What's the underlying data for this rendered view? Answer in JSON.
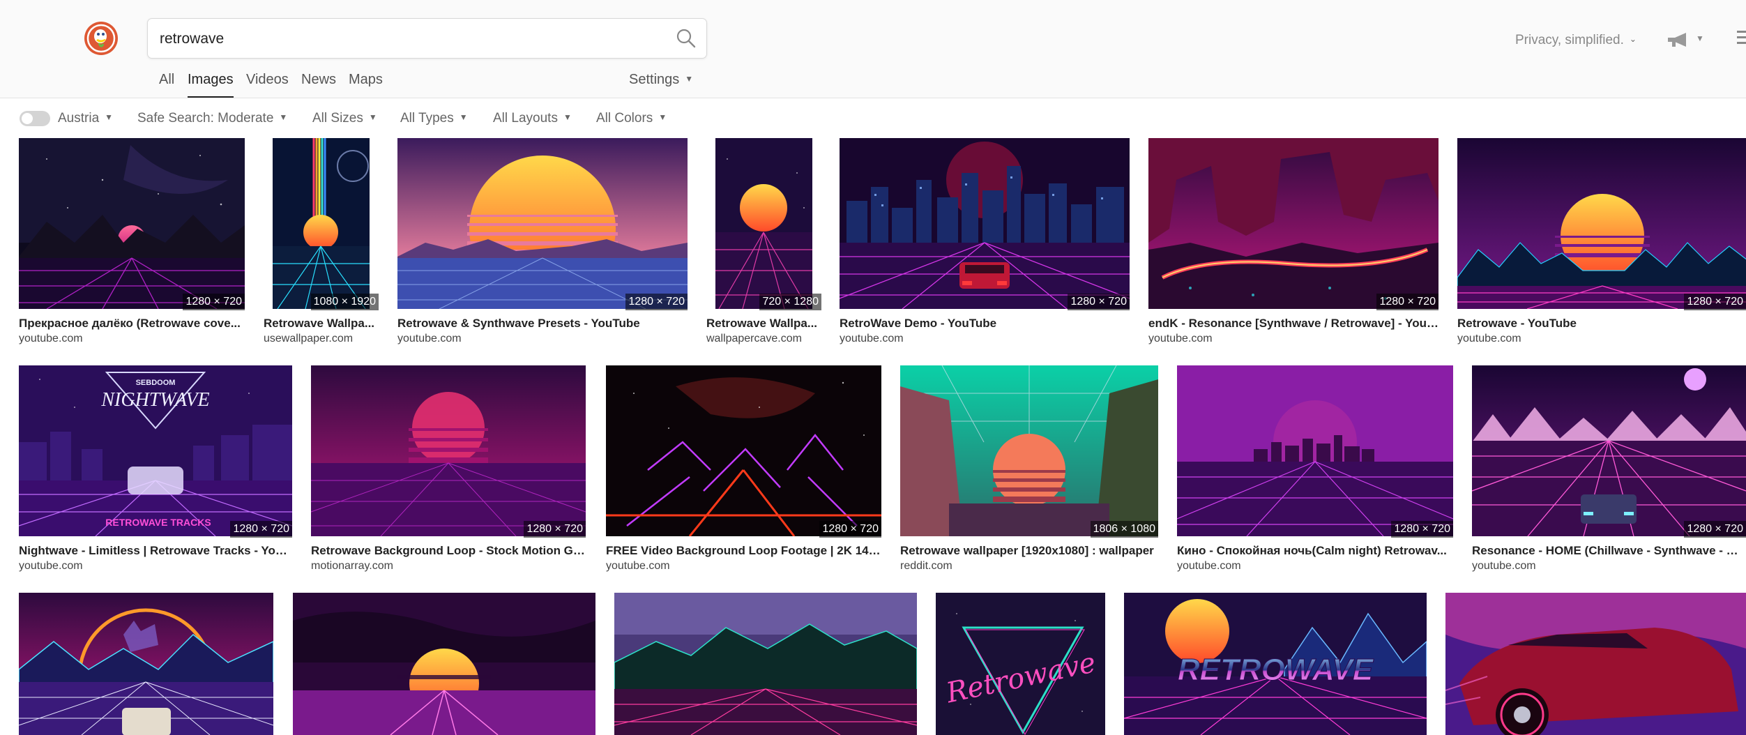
{
  "header": {
    "search_value": "retrowave",
    "tabs": [
      "All",
      "Images",
      "Videos",
      "News",
      "Maps"
    ],
    "settings_label": "Settings",
    "privacy_label": "Privacy, simplified."
  },
  "filters": {
    "region": "Austria",
    "safe_search": "Safe Search: Moderate",
    "sizes": "All Sizes",
    "types": "All Types",
    "layouts": "All Layouts",
    "colors": "All Colors"
  },
  "results": {
    "row1": [
      {
        "title": "Прекрасное далёко (Retrowave cove...",
        "source": "youtube.com",
        "dims": "1280 × 720"
      },
      {
        "title": "Retrowave Wallpa...",
        "source": "usewallpaper.com",
        "dims": "1080 × 1920"
      },
      {
        "title": "Retrowave & Synthwave Presets - YouTube",
        "source": "youtube.com",
        "dims": "1280 × 720"
      },
      {
        "title": "Retrowave Wallpa...",
        "source": "wallpapercave.com",
        "dims": "720 × 1280"
      },
      {
        "title": "RetroWave Demo - YouTube",
        "source": "youtube.com",
        "dims": "1280 × 720"
      },
      {
        "title": "endK - Resonance [Synthwave / Retrowave] - YouT...",
        "source": "youtube.com",
        "dims": "1280 × 720"
      },
      {
        "title": "Retrowave - YouTube",
        "source": "youtube.com",
        "dims": "1280 × 720"
      }
    ],
    "row2": [
      {
        "title": "Nightwave - Limitless | Retrowave Tracks - YouT...",
        "source": "youtube.com",
        "dims": "1280 × 720"
      },
      {
        "title": "Retrowave Background Loop - Stock Motion Gr...",
        "source": "motionarray.com",
        "dims": "1280 × 720"
      },
      {
        "title": "FREE Video Background Loop Footage | 2K 144...",
        "source": "youtube.com",
        "dims": "1280 × 720"
      },
      {
        "title": "Retrowave wallpaper [1920x1080] : wallpaper",
        "source": "reddit.com",
        "dims": "1806 × 1080"
      },
      {
        "title": "Кино - Спокойная ночь(Calm night) Retrowav...",
        "source": "youtube.com",
        "dims": "1280 × 720"
      },
      {
        "title": "Resonance - HOME (Chillwave - Synthwave - Re...",
        "source": "youtube.com",
        "dims": "1280 × 720"
      }
    ],
    "row2_overlay_text": {
      "nightwave_top": "SEBDOOM",
      "nightwave_title": "NIGHTWAVE",
      "nightwave_bottom": "RETROWAVE TRACKS"
    },
    "row3_overlay_text": {
      "retrowave_script": "Retrowave",
      "retrowave_chrome": "RETROWAVE"
    }
  }
}
